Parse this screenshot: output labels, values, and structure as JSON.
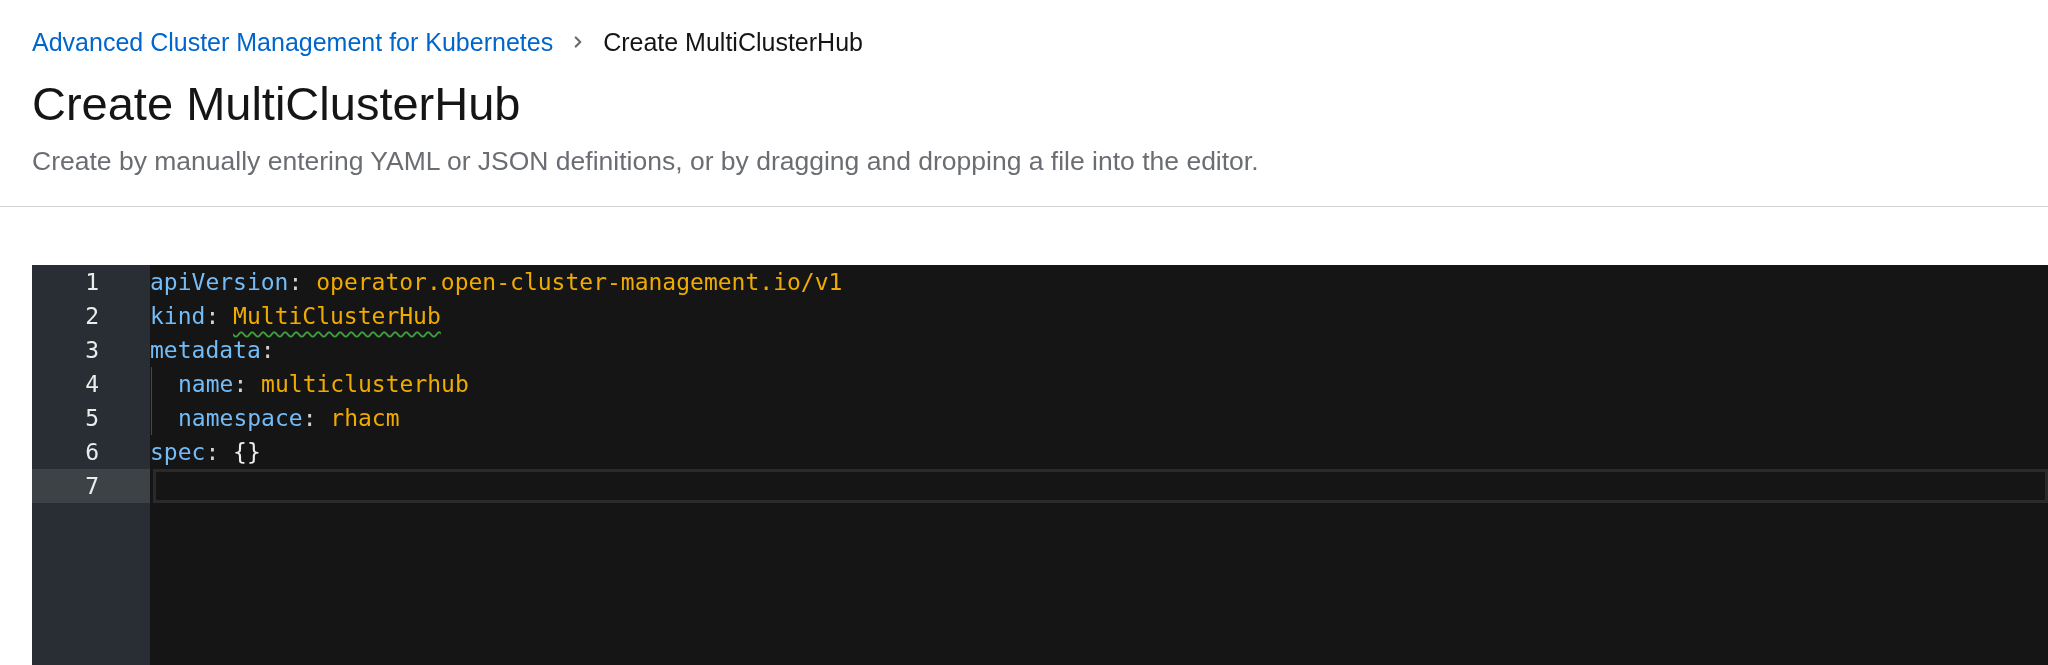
{
  "breadcrumb": [
    {
      "kind": "link",
      "label": "Advanced Cluster Management for Kubernetes"
    },
    {
      "kind": "current",
      "label": "Create MultiClusterHub"
    }
  ],
  "title": "Create MultiClusterHub",
  "description": "Create by manually entering YAML or JSON definitions, or by dragging and dropping a file into the editor.",
  "editor": {
    "lines": [
      {
        "number": "1",
        "active": false,
        "tokens": [
          {
            "kind": "key",
            "text": "apiVersion",
            "warning": false
          },
          {
            "kind": "punct",
            "text": ":",
            "warning": false
          },
          {
            "kind": "value",
            "text": "operator.open-cluster-management.io/v1",
            "warning": false
          }
        ]
      },
      {
        "number": "2",
        "active": false,
        "tokens": [
          {
            "kind": "key",
            "text": "kind",
            "warning": false
          },
          {
            "kind": "punct",
            "text": ":",
            "warning": false
          },
          {
            "kind": "value",
            "text": "MultiClusterHub",
            "warning": true
          }
        ]
      },
      {
        "number": "3",
        "active": false,
        "tokens": [
          {
            "kind": "key",
            "text": "metadata",
            "warning": false
          },
          {
            "kind": "punct",
            "text": ":",
            "warning": false
          }
        ],
        "children": [
          {
            "number": "4",
            "active": false,
            "tokens": [
              {
                "kind": "key",
                "text": "name",
                "warning": false
              },
              {
                "kind": "punct",
                "text": ":",
                "warning": false
              },
              {
                "kind": "value",
                "text": "multiclusterhub",
                "warning": false
              }
            ]
          },
          {
            "number": "5",
            "active": false,
            "tokens": [
              {
                "kind": "key",
                "text": "namespace",
                "warning": false
              },
              {
                "kind": "punct",
                "text": ":",
                "warning": false
              },
              {
                "kind": "value",
                "text": "rhacm",
                "warning": false
              }
            ]
          }
        ]
      },
      {
        "number": "6",
        "active": false,
        "tokens": [
          {
            "kind": "key",
            "text": "spec",
            "warning": false
          },
          {
            "kind": "punct",
            "text": ":",
            "warning": false
          },
          {
            "kind": "brace",
            "text": "{}",
            "warning": false
          }
        ]
      },
      {
        "number": "7",
        "active": true
      }
    ]
  }
}
